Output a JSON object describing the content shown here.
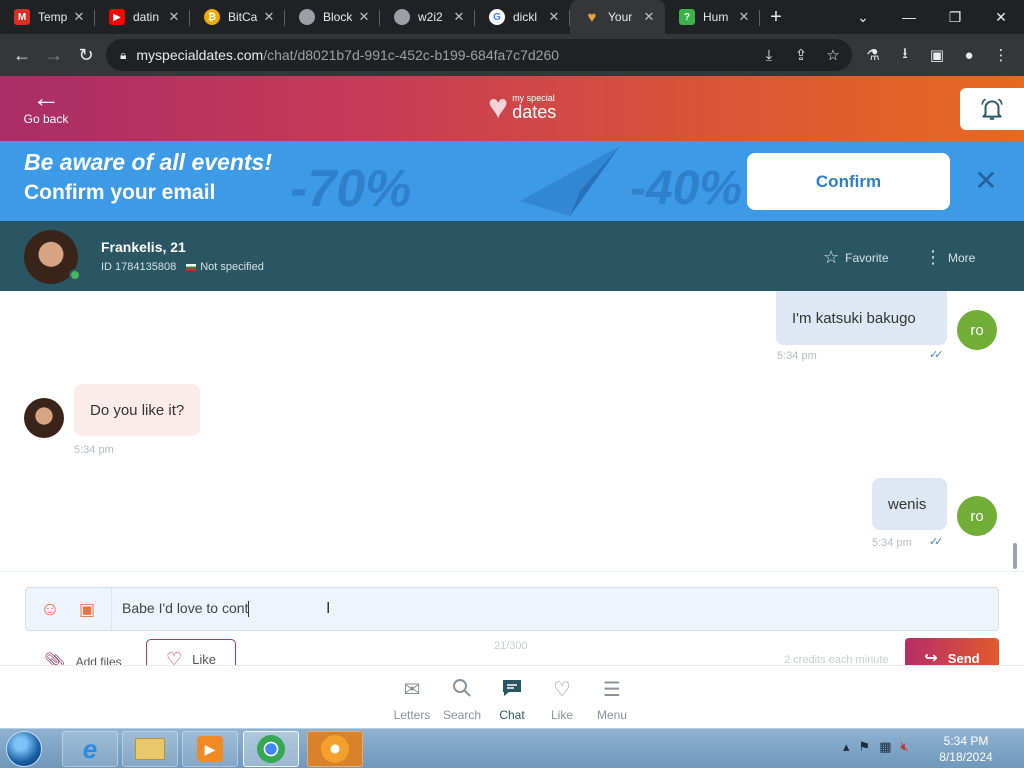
{
  "browser": {
    "tabs": [
      {
        "label": "Temp",
        "favicon_color": "#d93025"
      },
      {
        "label": "datin",
        "favicon_color": "#ff0000"
      },
      {
        "label": "BitCa",
        "favicon_color": "#f2a900"
      },
      {
        "label": "Block",
        "favicon_color": "#9aa0a6"
      },
      {
        "label": "w2i2",
        "favicon_color": "#9aa0a6"
      },
      {
        "label": "dickl",
        "favicon_color": "#4285f4"
      },
      {
        "label": "Your",
        "favicon_color": "#e8a33d"
      },
      {
        "label": "Hum",
        "favicon_color": "#3cb34a"
      }
    ],
    "active_tab_index": 6,
    "new_tab": "+",
    "url_host": "myspecialdates.com",
    "url_path": "/chat/d8021b7d-991c-452c-b199-684fa7c7d260"
  },
  "header": {
    "go_back": "Go back",
    "logo_small": "my special",
    "logo_big": "dates"
  },
  "promo": {
    "headline": "Be aware of all events!",
    "subline": "Confirm your email",
    "confirm_label": "Confirm",
    "deco_1": "-70%",
    "deco_2": "-40%"
  },
  "profile": {
    "name": "Frankelis, 21",
    "id_text": "ID 1784135808",
    "status_text": "Not specified",
    "favorite_label": "Favorite",
    "more_label": "More"
  },
  "messages": [
    {
      "direction": "out",
      "text": "I'm katsuki bakugo",
      "time": "5:34 pm",
      "avatar": "ro"
    },
    {
      "direction": "in",
      "text": "Do you like it?",
      "time": "5:34 pm"
    },
    {
      "direction": "out",
      "text": "wenis",
      "time": "5:34 pm",
      "avatar": "ro"
    }
  ],
  "composer": {
    "input_value": "Babe I'd love to cont",
    "counter": "21/300",
    "add_files_label": "Add files",
    "like_label": "Like",
    "credits_note": "2 credits each minute",
    "send_label": "Send"
  },
  "bottom_nav": [
    {
      "label": "Letters",
      "icon": "envelope-icon"
    },
    {
      "label": "Search",
      "icon": "search-icon"
    },
    {
      "label": "Chat",
      "icon": "chat-icon"
    },
    {
      "label": "Like",
      "icon": "heart-icon"
    },
    {
      "label": "Menu",
      "icon": "menu-icon"
    }
  ],
  "active_nav": "Chat",
  "taskbar": {
    "time": "5:34 PM",
    "date": "8/18/2024"
  },
  "colors": {
    "header_gradient_start": "#a92d66",
    "header_gradient_end": "#e8691f",
    "promo_blue": "#3d9ae6",
    "profile_bar": "#2a5664",
    "avatar_green": "#72ad37",
    "outgoing_bubble": "#dde8f4",
    "incoming_bubble": "#fbecec"
  }
}
